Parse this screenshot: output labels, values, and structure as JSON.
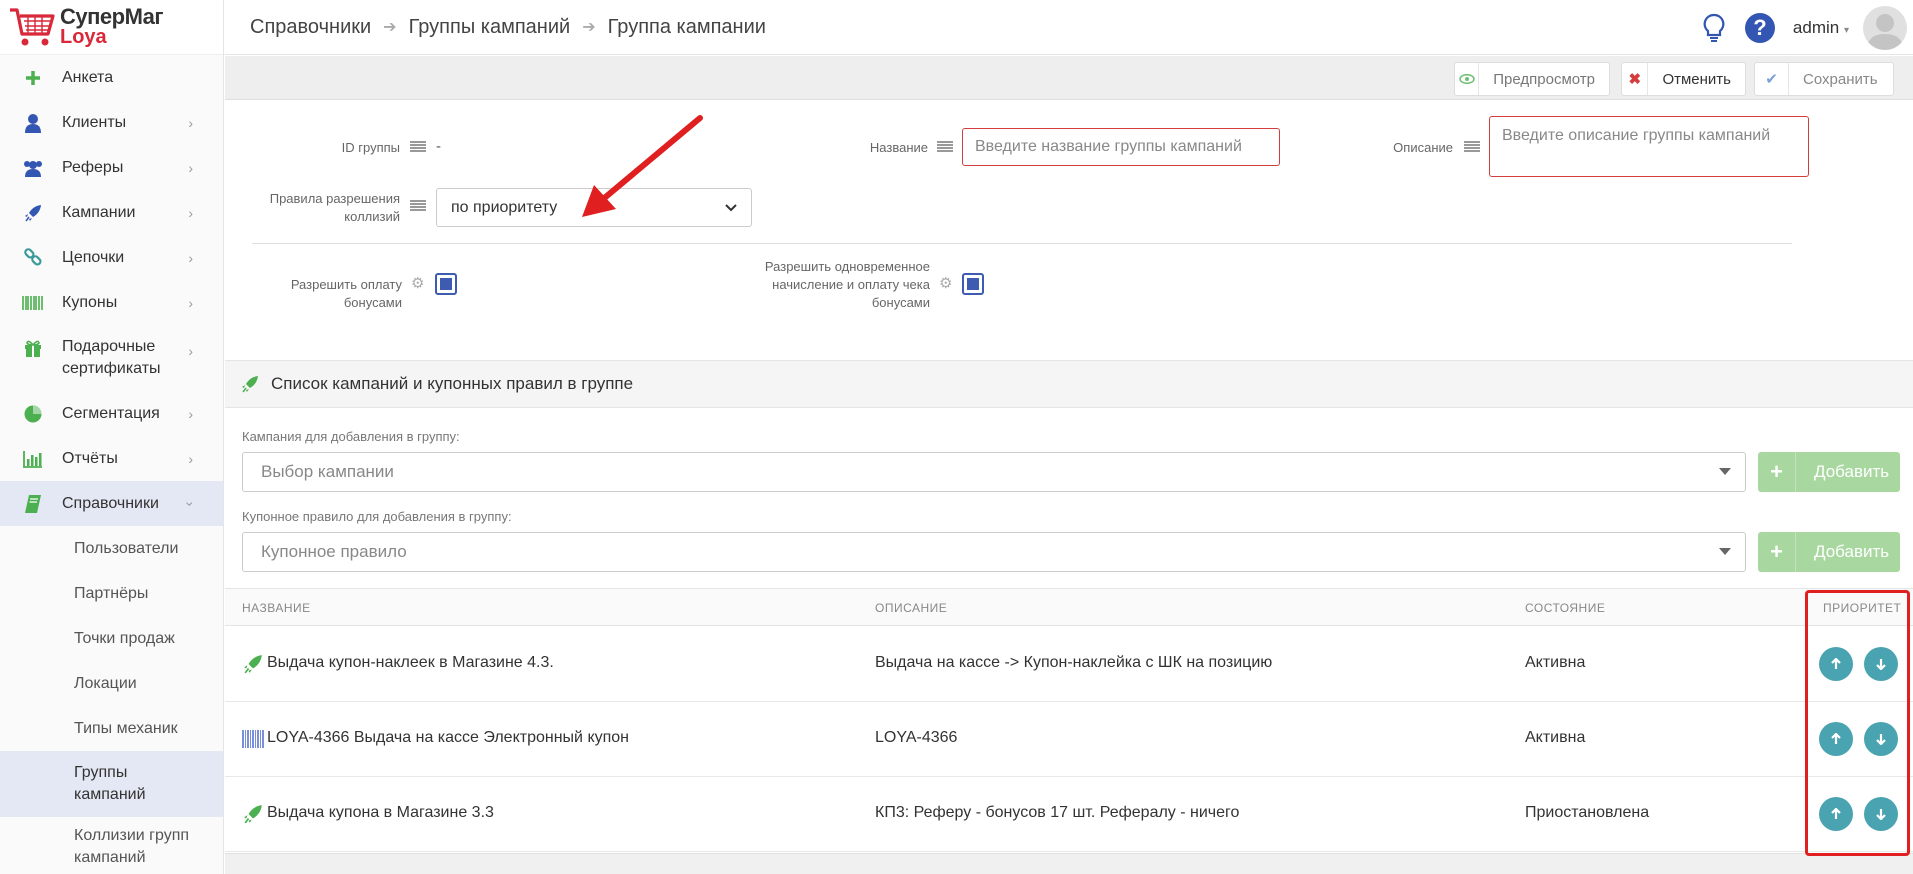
{
  "brand": {
    "line1": "СуперМаг",
    "line2": "Loya"
  },
  "sidebar": {
    "items": [
      {
        "label": "Анкета",
        "icon": "plus-icon"
      },
      {
        "label": "Клиенты",
        "icon": "user-icon"
      },
      {
        "label": "Реферы",
        "icon": "users-icon"
      },
      {
        "label": "Кампании",
        "icon": "rocket-icon"
      },
      {
        "label": "Цепочки",
        "icon": "link-icon"
      },
      {
        "label": "Купоны",
        "icon": "barcode-icon"
      },
      {
        "label": "Подарочные сертификаты",
        "icon": "gift-icon"
      },
      {
        "label": "Сегментация",
        "icon": "pie-chart-icon"
      },
      {
        "label": "Отчёты",
        "icon": "bar-chart-icon"
      },
      {
        "label": "Справочники",
        "icon": "book-icon"
      }
    ],
    "sub_items": [
      {
        "label": "Пользователи"
      },
      {
        "label": "Партнёры"
      },
      {
        "label": "Точки продаж"
      },
      {
        "label": "Локации"
      },
      {
        "label": "Типы механик"
      },
      {
        "label": "Группы кампаний"
      },
      {
        "label": "Коллизии групп кампаний"
      }
    ]
  },
  "header": {
    "breadcrumb": [
      "Справочники",
      "Группы кампаний",
      "Группа кампании"
    ],
    "user": "admin"
  },
  "toolbar": {
    "preview_label": "Предпросмотр",
    "cancel_label": "Отменить",
    "save_label": "Сохранить"
  },
  "form": {
    "id_label": "ID группы",
    "id_value": "-",
    "name_label": "Название",
    "name_placeholder": "Введите название группы кампаний",
    "desc_label": "Описание",
    "desc_placeholder": "Введите описание группы кампаний",
    "collision_label_1": "Правила разрешения",
    "collision_label_2": "коллизий",
    "collision_value": "по приоритету",
    "bonus_pay_label": "Разрешить оплату бонусами",
    "bonus_pay_checked": true,
    "simul_label_1": "Разрешить одновременное",
    "simul_label_2": "начисление и оплату чека",
    "simul_label_3": "бонусами",
    "simul_checked": true
  },
  "section": {
    "title": "Список кампаний и купонных правил в группе",
    "campaign_label": "Кампания для добавления в группу:",
    "campaign_placeholder": "Выбор кампании",
    "coupon_label": "Купонное правило для добавления в группу:",
    "coupon_placeholder": "Купонное правило",
    "add_label": "Добавить"
  },
  "table": {
    "headers": [
      "Название",
      "Описание",
      "Состояние",
      "Приоритет"
    ],
    "rows": [
      {
        "icon": "rocket-icon",
        "name": "Выдача купон-наклеек в Магазине 4.3.",
        "desc": "Выдача на кассе -> Купон-наклейка с ШК на позицию",
        "state": "Активна"
      },
      {
        "icon": "barcode-icon",
        "name": "LOYA-4366 Выдача на кассе Электронный купон",
        "desc": "LOYA-4366",
        "state": "Активна"
      },
      {
        "icon": "rocket-icon",
        "name": "Выдача купона в Магазине 3.3",
        "desc": "КП3: Реферу - бонусов 17 шт. Рефералу - ничего",
        "state": "Приостановлена"
      }
    ]
  },
  "colors": {
    "accent": "#3d5bb0",
    "brand_red": "#d8283a",
    "green": "#4caf50",
    "teal": "#4aa3b0",
    "annotation_red": "#e02020"
  }
}
